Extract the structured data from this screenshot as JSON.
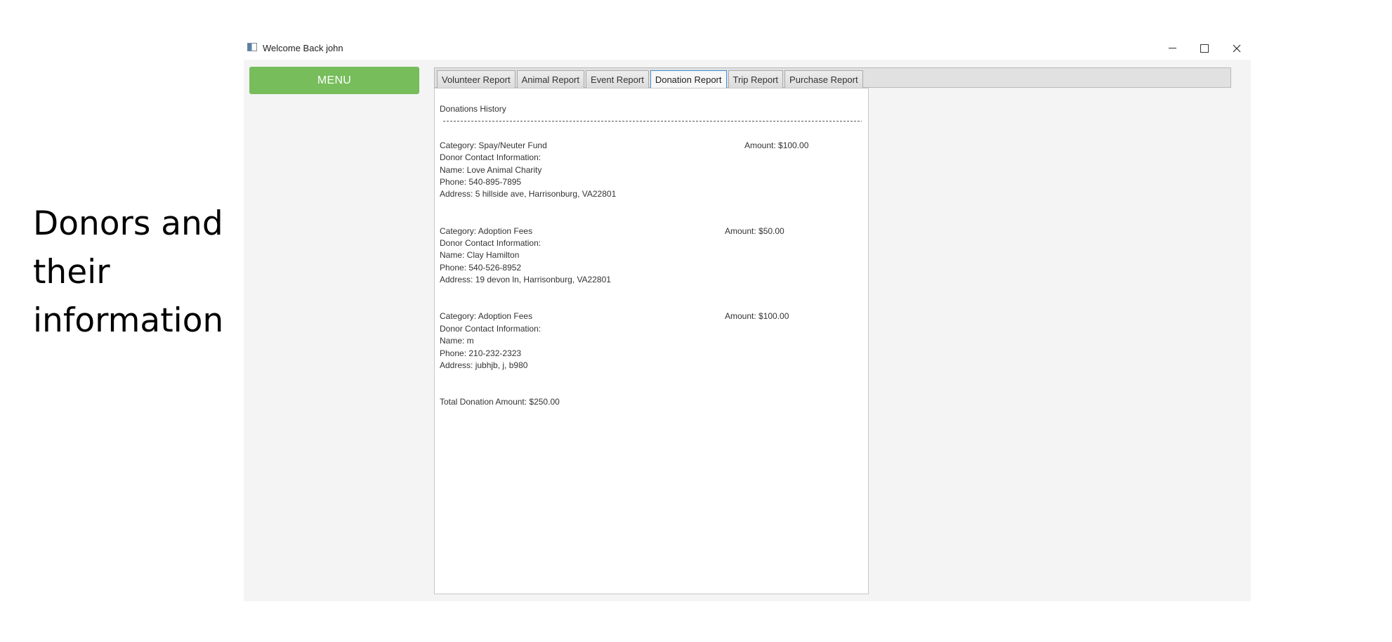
{
  "caption": "Donors and their information",
  "window": {
    "title": "Welcome Back john"
  },
  "menu": {
    "label": "MENU"
  },
  "tabs": [
    {
      "label": "Volunteer Report",
      "active": false
    },
    {
      "label": "Animal Report",
      "active": false
    },
    {
      "label": "Event Report",
      "active": false
    },
    {
      "label": "Donation Report",
      "active": true
    },
    {
      "label": "Trip Report",
      "active": false
    },
    {
      "label": "Purchase Report",
      "active": false
    }
  ],
  "report": {
    "heading": "Donations History",
    "donations": [
      {
        "category": "Category: Spay/Neuter Fund",
        "amount": "Amount: $100.00",
        "contact_label": "Donor Contact Information:",
        "name": "Name: Love Animal Charity",
        "phone": "Phone: 540-895-7895",
        "address": "Address: 5 hillside ave, Harrisonburg, VA22801"
      },
      {
        "category": "Category: Adoption Fees",
        "amount": "Amount: $50.00",
        "contact_label": "Donor Contact Information:",
        "name": "Name: Clay Hamilton",
        "phone": "Phone: 540-526-8952",
        "address": "Address: 19 devon ln, Harrisonburg, VA22801"
      },
      {
        "category": "Category: Adoption Fees",
        "amount": "Amount: $100.00",
        "contact_label": "Donor Contact Information:",
        "name": "Name: m",
        "phone": "Phone: 210-232-2323",
        "address": "Address: jubhjb, j, b980"
      }
    ],
    "total": "Total Donation Amount: $250.00"
  },
  "colors": {
    "menu_button": "#77bd5b",
    "active_tab_border": "#3d8fd6"
  },
  "icons": {
    "app": "app-icon",
    "minimize": "minimize-icon",
    "maximize": "maximize-icon",
    "close": "close-icon"
  }
}
